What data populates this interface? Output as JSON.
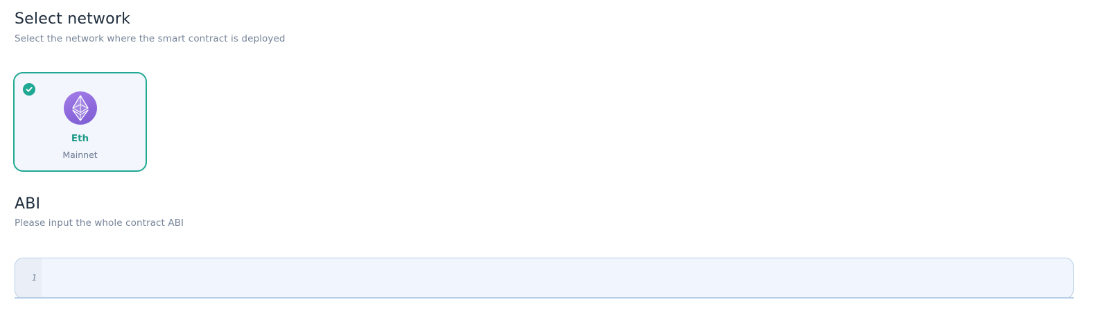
{
  "network_section": {
    "title": "Select network",
    "subtitle": "Select the network where the smart contract is deployed",
    "selected_network": {
      "name": "Eth",
      "type": "Mainnet",
      "icon": "ethereum-icon",
      "selected_icon": "check-circle-icon",
      "accent_color": "#1fa893"
    }
  },
  "abi_section": {
    "title": "ABI",
    "subtitle": "Please input the whole contract ABI",
    "editor": {
      "line_numbers": [
        "1"
      ],
      "value": ""
    }
  }
}
